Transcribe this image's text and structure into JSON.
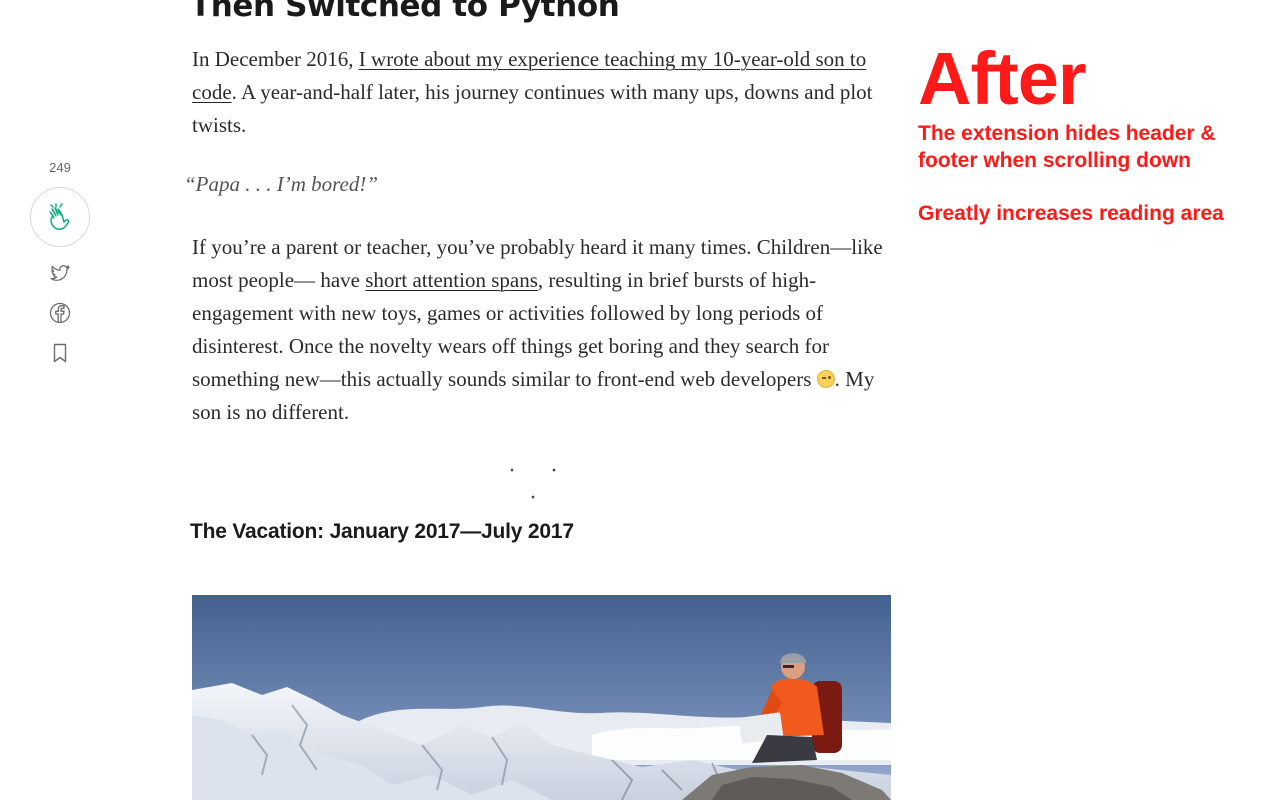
{
  "article": {
    "title": "Then Switched to Python",
    "p1": {
      "before": "In December 2016, ",
      "link": "I wrote about my experience teaching my 10-year-old son to code",
      "after": ". A year-and-half later, his journey continues with many ups, downs and plot twists."
    },
    "quote": "“Papa . . . I’m bored!”",
    "p2": {
      "before": "If you’re a parent or teacher, you’ve probably heard it many times. Children—like most people— have ",
      "link": "short attention spans",
      "middle": ", resulting in brief bursts of high-engagement with new toys, games or activities followed by long periods of disinterest. Once the novelty wears off things get boring and they search for something new—this actually sounds similar to front-end web developers ",
      "after": ". My son is no different."
    },
    "separator": "· · ·",
    "section_heading": "The Vacation: January 2017—July 2017",
    "hero_image": "mountain-hiker-with-laptop"
  },
  "share_rail": {
    "clap_count": "249",
    "icons": [
      "clap-icon",
      "twitter-icon",
      "facebook-icon",
      "bookmark-icon"
    ],
    "accent_color": "#03a87c"
  },
  "annotation": {
    "title": "After",
    "line1": "The extension hides header & footer when scrolling down",
    "line2": "Greatly increases reading area",
    "color": "#ff1a1a"
  }
}
